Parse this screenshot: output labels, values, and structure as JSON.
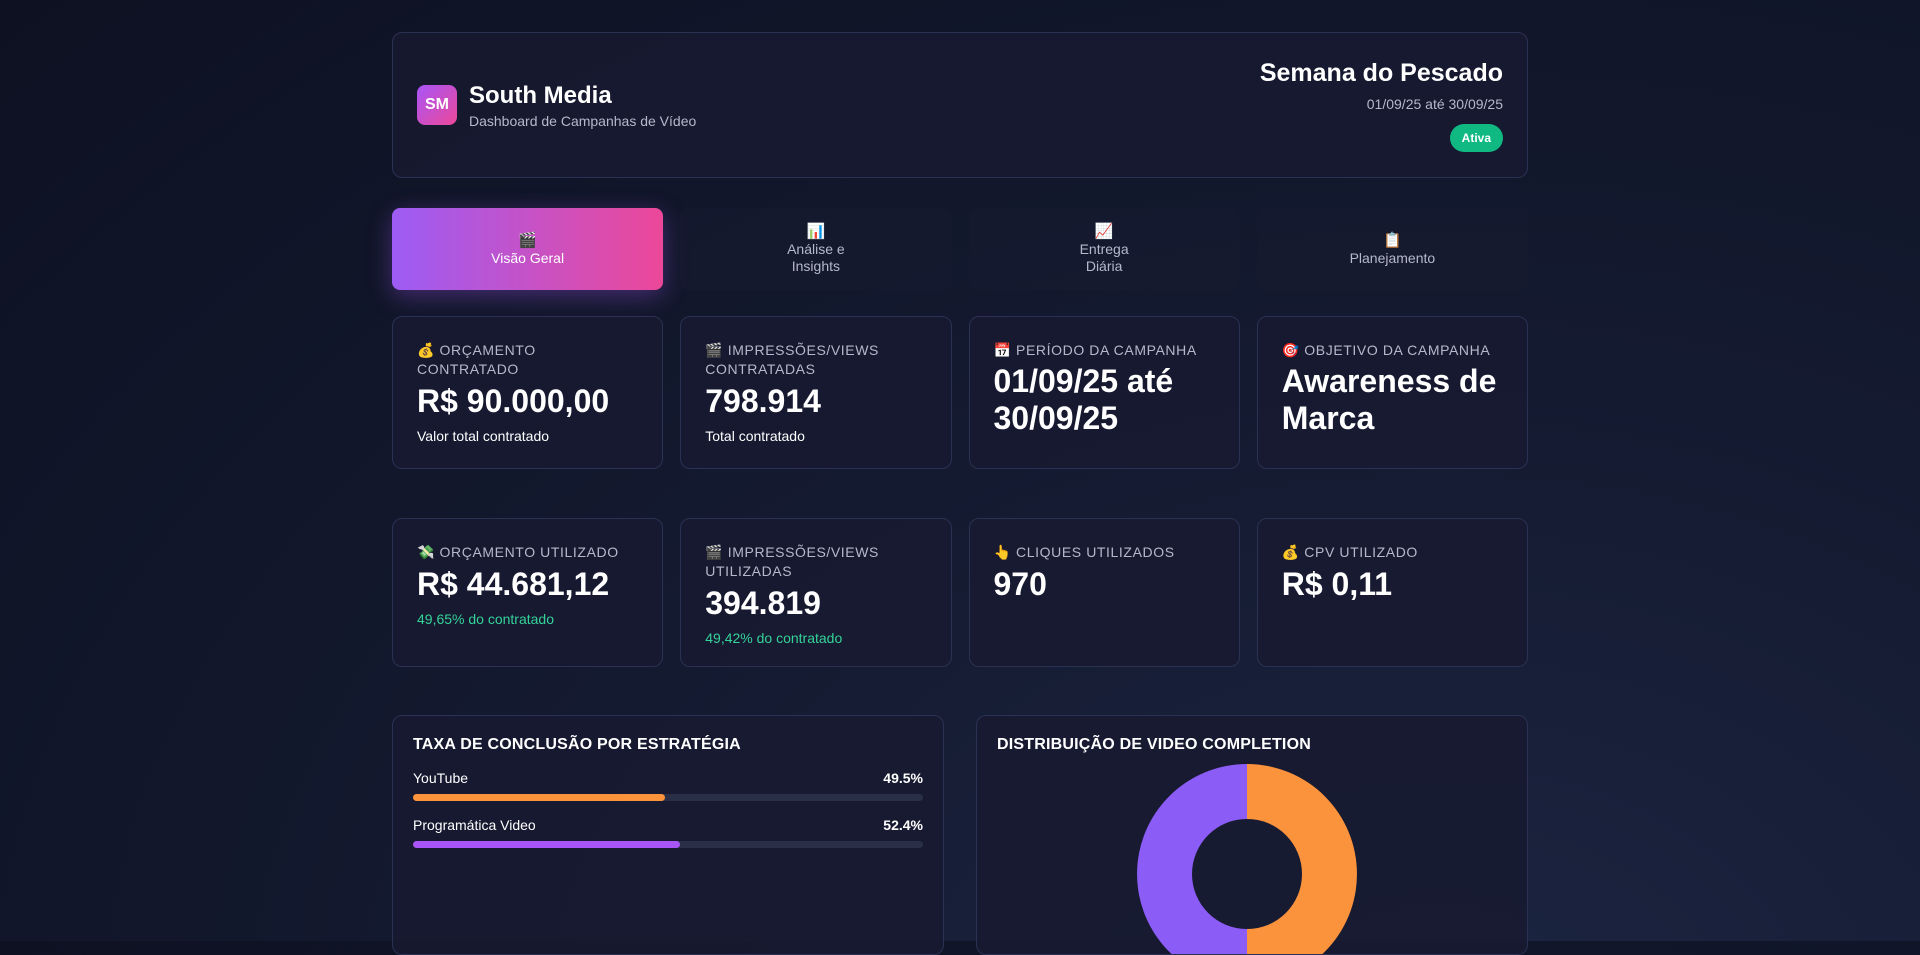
{
  "header": {
    "logo_text": "SM",
    "brand_name": "South Media",
    "brand_subtitle": "Dashboard de Campanhas de Vídeo",
    "campaign_name": "Semana do Pescado",
    "campaign_dates": "01/09/25 até 30/09/25",
    "status_badge": "Ativa"
  },
  "tabs": [
    {
      "icon": "🎬",
      "label": "Visão Geral",
      "active": true
    },
    {
      "icon": "📊",
      "label": "Análise e Insights",
      "active": false
    },
    {
      "icon": "📈",
      "label": "Entrega Diária",
      "active": false
    },
    {
      "icon": "📋",
      "label": "Planejamento",
      "active": false
    }
  ],
  "contracted": [
    {
      "icon": "💰",
      "label": "ORÇAMENTO CONTRATADO",
      "value": "R$ 90.000,00",
      "note": "Valor total contratado"
    },
    {
      "icon": "🎬",
      "label": "IMPRESSÕES/VIEWS CONTRATADAS",
      "value": "798.914",
      "note": "Total contratado"
    },
    {
      "icon": "📅",
      "label": "PERÍODO DA CAMPANHA",
      "value": "01/09/25 até 30/09/25",
      "note": ""
    },
    {
      "icon": "🎯",
      "label": "OBJETIVO DA CAMPANHA",
      "value": "Awareness de Marca",
      "note": ""
    }
  ],
  "used": [
    {
      "icon": "💸",
      "label": "ORÇAMENTO UTILIZADO",
      "value": "R$ 44.681,12",
      "note": "49,65% do contratado"
    },
    {
      "icon": "🎬",
      "label": "IMPRESSÕES/VIEWS UTILIZADAS",
      "value": "394.819",
      "note": "49,42% do contratado"
    },
    {
      "icon": "👆",
      "label": "CLIQUES UTILIZADOS",
      "value": "970",
      "note": ""
    },
    {
      "icon": "💰",
      "label": "CPV UTILIZADO",
      "value": "R$ 0,11",
      "note": ""
    }
  ],
  "completion_panel": {
    "title": "TAXA DE CONCLUSÃO POR ESTRATÉGIA",
    "rows": [
      {
        "name": "YouTube",
        "value_label": "49.5%",
        "value": 49.5,
        "color": "#fb923c"
      },
      {
        "name": "Programática Video",
        "value_label": "52.4%",
        "value": 52.4,
        "color": "#a855f7"
      }
    ]
  },
  "distribution_panel": {
    "title": "DISTRIBUIÇÃO DE VIDEO COMPLETION"
  },
  "chart_data": {
    "type": "pie",
    "title": "DISTRIBUIÇÃO DE VIDEO COMPLETION",
    "categories": [
      "",
      ""
    ],
    "values": [
      50,
      50
    ],
    "colors": [
      "#fb923c",
      "#8b5cf6"
    ]
  }
}
